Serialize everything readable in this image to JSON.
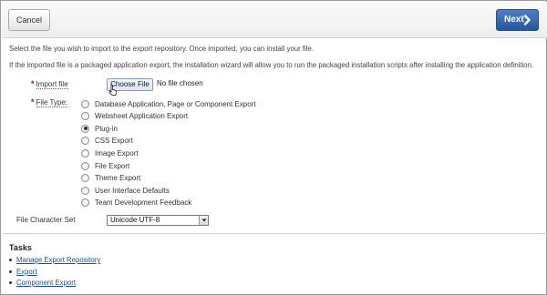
{
  "toolbar": {
    "cancel_label": "Cancel",
    "next_label": "Next"
  },
  "description": {
    "line1": "Select the file you wish to import to the export repository. Once imported, you can install your file.",
    "line2": "If the imported file is a packaged application export, the installation wizard will allow you to run the packaged installation scripts after installing the application definition."
  },
  "import_file": {
    "label": "Import file",
    "button_label": "Choose File",
    "status": "No file chosen"
  },
  "file_type": {
    "label": "File Type:",
    "options": [
      {
        "label": "Database Application, Page or Component Export",
        "checked": false
      },
      {
        "label": "Websheet Application Export",
        "checked": false
      },
      {
        "label": "Plug-in",
        "checked": true
      },
      {
        "label": "CSS Export",
        "checked": false
      },
      {
        "label": "Image Export",
        "checked": false
      },
      {
        "label": "File Export",
        "checked": false
      },
      {
        "label": "Theme Export",
        "checked": false
      },
      {
        "label": "User Interface Defaults",
        "checked": false
      },
      {
        "label": "Team Development Feedback",
        "checked": false
      }
    ]
  },
  "charset": {
    "label": "File Character Set",
    "selected": "Unicode UTF-8"
  },
  "tasks": {
    "title": "Tasks",
    "links": [
      {
        "label": "Manage Export Repository"
      },
      {
        "label": "Export"
      },
      {
        "label": "Component Export"
      }
    ]
  },
  "colors": {
    "next_button": "#28569b",
    "required_marker": "#cc0000",
    "link": "#1a4f9c"
  }
}
